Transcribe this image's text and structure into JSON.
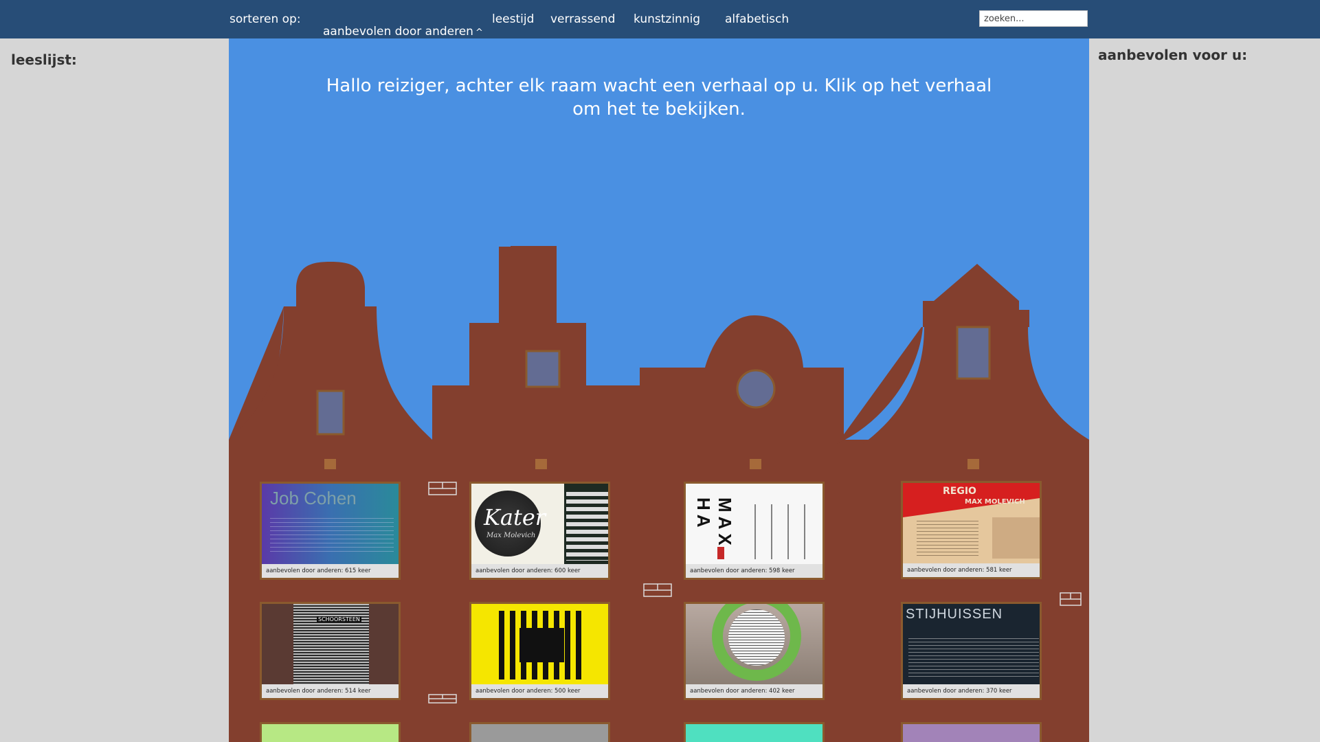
{
  "nav": {
    "sort_label": "sorteren op:",
    "options": [
      {
        "label": "aanbevolen door anderen",
        "active": true
      },
      {
        "label": "leestijd"
      },
      {
        "label": "verrassend"
      },
      {
        "label": "kunstzinnig"
      },
      {
        "label": "alfabetisch"
      }
    ],
    "search_placeholder": "zoeken..."
  },
  "left_sidebar": {
    "title": "leeslijst:"
  },
  "right_sidebar": {
    "title": "aanbevolen voor u:"
  },
  "main": {
    "welcome_line1": "Hallo reiziger, achter elk raam wacht een verhaal op u. Klik op het verhaal",
    "welcome_line2": "om het te bekijken."
  },
  "stories": [
    {
      "thumb_title": "Job Cohen",
      "label": "aanbevolen door anderen: 615 keer"
    },
    {
      "thumb_title": "Kater",
      "thumb_subtitle": "Max Molevich",
      "label": "aanbevolen door anderen: 600 keer"
    },
    {
      "thumb_title": "MAX HA",
      "label": "aanbevolen door anderen: 598 keer"
    },
    {
      "thumb_title": "REGIO",
      "thumb_subtitle": "MAX MOLEVICH",
      "label": "aanbevolen door anderen: 581 keer"
    },
    {
      "thumb_title": "SCHOORSTEEN",
      "label": "aanbevolen door anderen: 514 keer"
    },
    {
      "label": "aanbevolen door anderen: 500 keer"
    },
    {
      "label": "aanbevolen door anderen: 402 keer"
    },
    {
      "thumb_title": "STIJHUISSEN",
      "label": "aanbevolen door anderen: 370 keer"
    }
  ],
  "colors": {
    "topbar": "#274d77",
    "sky": "#4a90e2",
    "brick": "#833f2e",
    "window": "#636c93",
    "frame": "#8a5a2e",
    "sidebar": "#d6d6d6"
  }
}
